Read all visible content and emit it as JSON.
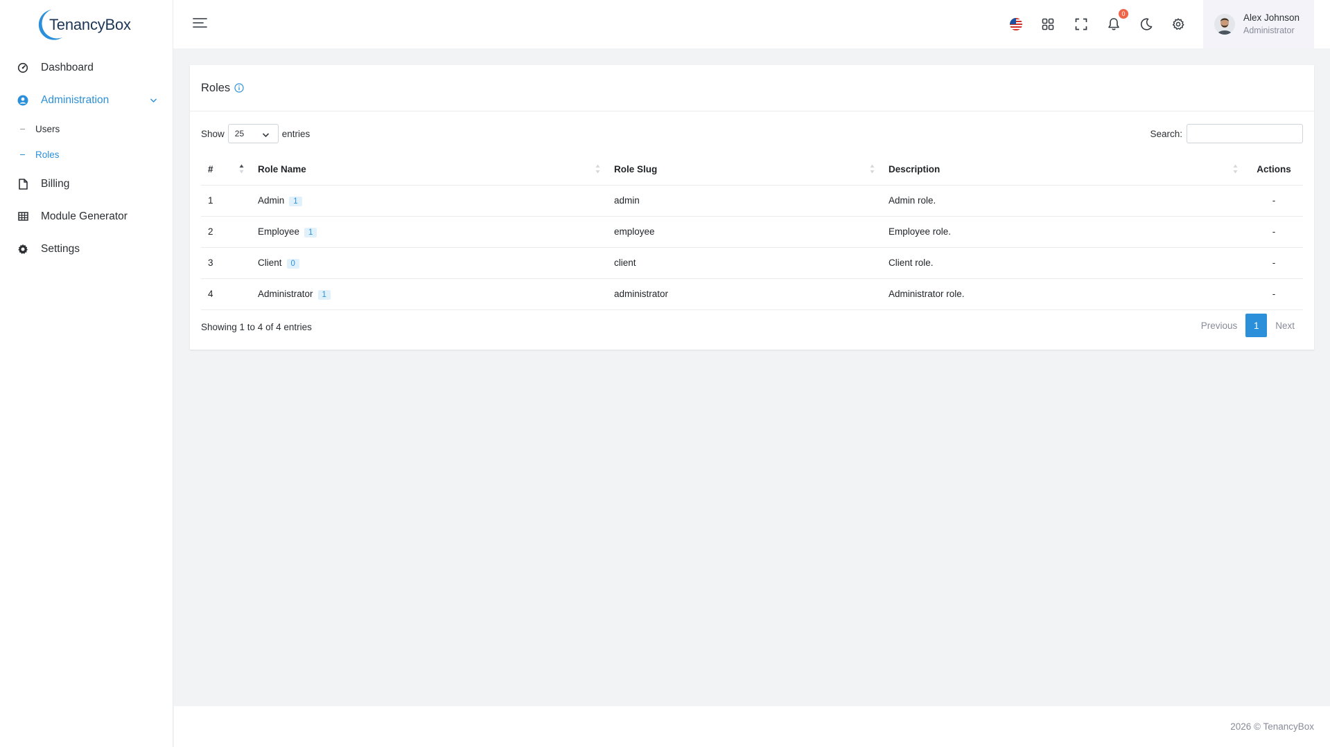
{
  "brand": {
    "name": "TenancyBox"
  },
  "sidebar": {
    "items": [
      {
        "label": "Dashboard",
        "icon": "dashboard-icon"
      },
      {
        "label": "Administration",
        "icon": "user-circle-icon"
      },
      {
        "label": "Billing",
        "icon": "file-icon"
      },
      {
        "label": "Module Generator",
        "icon": "grid-icon"
      },
      {
        "label": "Settings",
        "icon": "gear-icon"
      }
    ],
    "subitems": [
      {
        "label": "Users"
      },
      {
        "label": "Roles"
      }
    ]
  },
  "topbar": {
    "notifications_count": "0",
    "user": {
      "name": "Alex Johnson",
      "role": "Administrator"
    }
  },
  "card": {
    "title": "Roles",
    "show_label": "Show",
    "entries_value": "25",
    "entries_label": "entries",
    "search_label": "Search:",
    "search_value": ""
  },
  "table": {
    "headers": [
      "#",
      "Role Name",
      "Role Slug",
      "Description",
      "Actions"
    ],
    "rows": [
      {
        "num": "1",
        "name": "Admin",
        "count": "1",
        "slug": "admin",
        "description": "Admin role.",
        "actions": "-"
      },
      {
        "num": "2",
        "name": "Employee",
        "count": "1",
        "slug": "employee",
        "description": "Employee role.",
        "actions": "-"
      },
      {
        "num": "3",
        "name": "Client",
        "count": "0",
        "slug": "client",
        "description": "Client role.",
        "actions": "-"
      },
      {
        "num": "4",
        "name": "Administrator",
        "count": "1",
        "slug": "administrator",
        "description": "Administrator role.",
        "actions": "-"
      }
    ]
  },
  "pagination": {
    "info": "Showing 1 to 4 of 4 entries",
    "previous": "Previous",
    "current": "1",
    "next": "Next"
  },
  "footer": {
    "text": "2026 © TenancyBox"
  },
  "colors": {
    "accent": "#2b90d9",
    "badge": "#f06548",
    "brand_dark": "#1d3557"
  }
}
